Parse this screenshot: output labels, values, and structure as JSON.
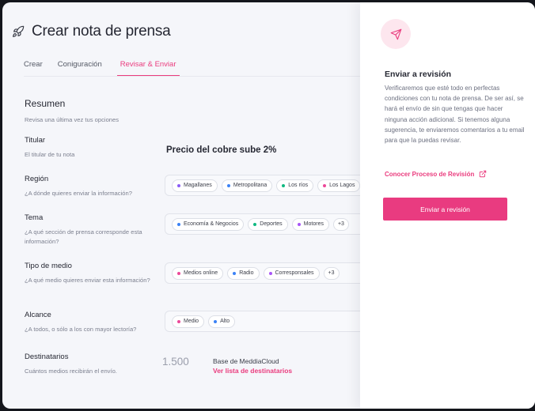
{
  "header": {
    "title": "Crear nota de prensa",
    "icon": "rocket-icon"
  },
  "tabs": [
    {
      "label": "Crear",
      "active": false
    },
    {
      "label": "Coniguración",
      "active": false
    },
    {
      "label": "Revisar & Enviar",
      "active": true
    }
  ],
  "summary": {
    "title": "Resumen",
    "subtitle": "Revisa una última vez tus opciones"
  },
  "titular": {
    "label": "Titular",
    "desc": "El titular de tu nota",
    "value": "Precio del cobre sube 2%"
  },
  "region": {
    "label": "Región",
    "desc": "¿A dónde quieres enviar la información?",
    "chips": [
      {
        "label": "Magallanes",
        "color": "#8b5cf6"
      },
      {
        "label": "Metropolitana",
        "color": "#3b82f6"
      },
      {
        "label": "Los ríos",
        "color": "#10b981"
      },
      {
        "label": "Los Lagos",
        "color": "#ec4899"
      }
    ]
  },
  "tema": {
    "label": "Tema",
    "desc": "¿A qué sección de prensa corresponde esta información?",
    "chips": [
      {
        "label": "Economía & Negocios",
        "color": "#3b82f6"
      },
      {
        "label": "Deportes",
        "color": "#10b981"
      },
      {
        "label": "Motores",
        "color": "#a855f7"
      }
    ],
    "more": "+3"
  },
  "tipo": {
    "label": "Tipo de medio",
    "desc": "¿A qué medio quieres enviar esta información?",
    "chips": [
      {
        "label": "Medios online",
        "color": "#ec4899"
      },
      {
        "label": "Radio",
        "color": "#3b82f6"
      },
      {
        "label": "Corresponsales",
        "color": "#a855f7"
      }
    ],
    "more": "+3"
  },
  "alcance": {
    "label": "Alcance",
    "desc": "¿A todos, o sólo a los con mayor lectoría?",
    "chips": [
      {
        "label": "Medio",
        "color": "#ec4899"
      },
      {
        "label": "Alto",
        "color": "#3b82f6"
      }
    ]
  },
  "destinatarios": {
    "label": "Destinatarios",
    "desc": "Cuántos medios recibirán el envío.",
    "count": "1.500",
    "base": "Base de MeddiaCloud",
    "link": "Ver lista de destinatarios"
  },
  "panel": {
    "icon": "send-icon",
    "title": "Enviar a revisión",
    "text": "Verificaremos que esté todo en perfectas condiciones con tu nota de prensa. De ser así, se hará el envío de sin que tengas que hacer ninguna acción adicional. Si tenemos alguna sugerencia, te enviaremos comentarios a tu email para que la puedas revisar.",
    "link": "Conocer Proceso de Revisión",
    "button": "Enviar a revisión"
  },
  "colors": {
    "accent": "#ea3c7e",
    "panel_bg": "#ffffff",
    "page_bg": "#f5f6fa"
  }
}
